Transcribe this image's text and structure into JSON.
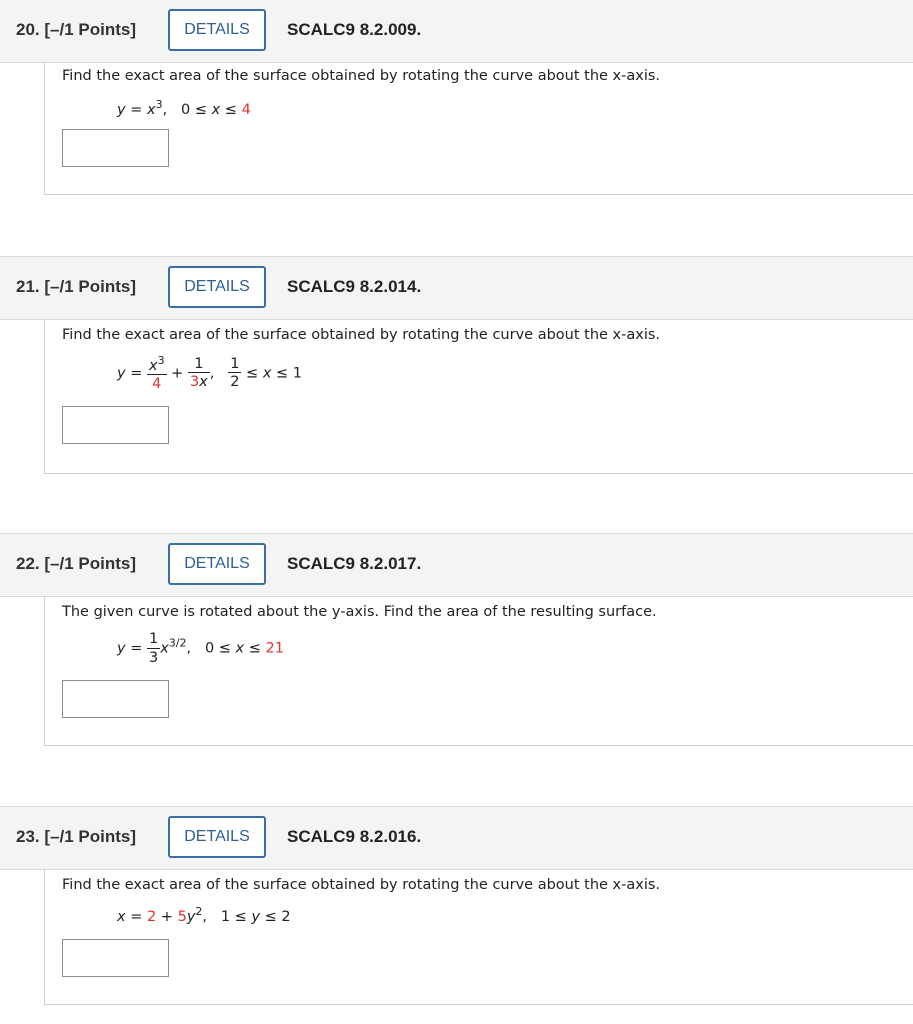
{
  "questions": [
    {
      "number": "20.",
      "points": "[–/1 Points]",
      "details_label": "DETAILS",
      "code": "SCALC9 8.2.009.",
      "prompt": "Find the exact area of the surface obtained by rotating the curve about the x-axis.",
      "equation": {
        "lhs": "y",
        "eq": "=",
        "base": "x",
        "exp": "3",
        "comma": ",",
        "range_low": "0 ≤ ",
        "range_var": "x",
        "range_mid": " ≤ ",
        "range_high": "4"
      }
    },
    {
      "number": "21.",
      "points": "[–/1 Points]",
      "details_label": "DETAILS",
      "code": "SCALC9 8.2.014.",
      "prompt": "Find the exact area of the surface obtained by rotating the curve about the x-axis.",
      "equation": {
        "lhs": "y",
        "eq": "=",
        "frac1_num_base": "x",
        "frac1_num_exp": "3",
        "frac1_den": "4",
        "plus": "+",
        "frac2_num": "1",
        "frac2_den_coef": "3",
        "frac2_den_var": "x",
        "comma": ",",
        "range_num": "1",
        "range_den": "2",
        "range_mid": " ≤ ",
        "range_var": "x",
        "range_high": " ≤ 1"
      }
    },
    {
      "number": "22.",
      "points": "[–/1 Points]",
      "details_label": "DETAILS",
      "code": "SCALC9 8.2.017.",
      "prompt": "The given curve is rotated about the y-axis. Find the area of the resulting surface.",
      "equation": {
        "lhs": "y",
        "eq": "=",
        "frac_num": "1",
        "frac_den": "3",
        "base": "x",
        "exp": "3/2",
        "comma": ",",
        "range_low": "0 ≤ ",
        "range_var": "x",
        "range_mid": " ≤ ",
        "range_high": "21"
      }
    },
    {
      "number": "23.",
      "points": "[–/1 Points]",
      "details_label": "DETAILS",
      "code": "SCALC9 8.2.016.",
      "prompt": "Find the exact area of the surface obtained by rotating the curve about the x-axis.",
      "equation": {
        "lhs": "x",
        "eq": "=",
        "const": "2",
        "plus": "+",
        "coef": "5",
        "var": "y",
        "exp": "2",
        "comma": ",",
        "range_low": "1 ≤ ",
        "range_var": "y",
        "range_high": " ≤ 2"
      }
    }
  ],
  "colors": {
    "accent": "#3a6ea5",
    "given_value_red": "#e0332f",
    "header_bg": "#f4f4f4"
  }
}
